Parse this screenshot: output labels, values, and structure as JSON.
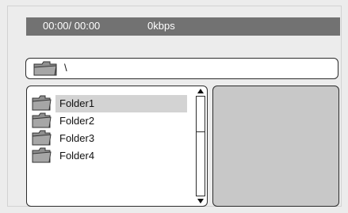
{
  "status": {
    "time": "00:00/ 00:00",
    "bitrate": "0kbps"
  },
  "path": {
    "icon": "folder-icon",
    "text": "\\"
  },
  "files": [
    {
      "label": "Folder1",
      "icon": "folder-icon",
      "selected": true
    },
    {
      "label": "Folder2",
      "icon": "folder-icon",
      "selected": false
    },
    {
      "label": "Folder3",
      "icon": "folder-icon",
      "selected": false
    },
    {
      "label": "Folder4",
      "icon": "folder-icon",
      "selected": false
    }
  ],
  "colors": {
    "status_bar": "#727272",
    "selection": "#d3d3d3",
    "preview": "#c8c8c8",
    "border": "#2c2c2c"
  }
}
